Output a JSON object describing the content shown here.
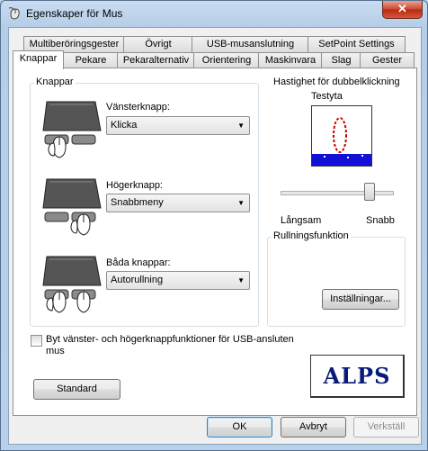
{
  "window": {
    "title": "Egenskaper för Mus",
    "close_glyph": "✕"
  },
  "tabs": {
    "row1": [
      "Multiberöringsgester",
      "Övrigt",
      "USB-musanslutning",
      "SetPoint Settings"
    ],
    "row2": [
      "Knappar",
      "Pekare",
      "Pekaralternativ",
      "Orientering",
      "Maskinvara",
      "Slag",
      "Gester"
    ],
    "active": "Knappar"
  },
  "buttons_group": {
    "title": "Knappar",
    "left": {
      "label": "Vänsterknapp:",
      "value": "Klicka"
    },
    "right": {
      "label": "Högerknapp:",
      "value": "Snabbmeny"
    },
    "both": {
      "label": "Båda knappar:",
      "value": "Autorullning"
    }
  },
  "doubleclick": {
    "title": "Hastighet för dubbelklickning",
    "test_label": "Testyta",
    "slow": "Långsam",
    "fast": "Snabb",
    "speed_level": 0.8
  },
  "scroll": {
    "title": "Rullningsfunktion",
    "settings_button": "Inställningar..."
  },
  "swap_checkbox": {
    "label_line1": "Byt vänster- och högerknappfunktioner för USB-ansluten",
    "label_line2": "mus",
    "checked": false
  },
  "standard_button": "Standard",
  "logo_text": "ALPS",
  "footer": {
    "ok": "OK",
    "cancel": "Avbryt",
    "apply": "Verkställ"
  },
  "colors": {
    "accent_blue": "#0000cc",
    "test_area_blue": "#1010d8",
    "oval_red": "#cc0000"
  }
}
